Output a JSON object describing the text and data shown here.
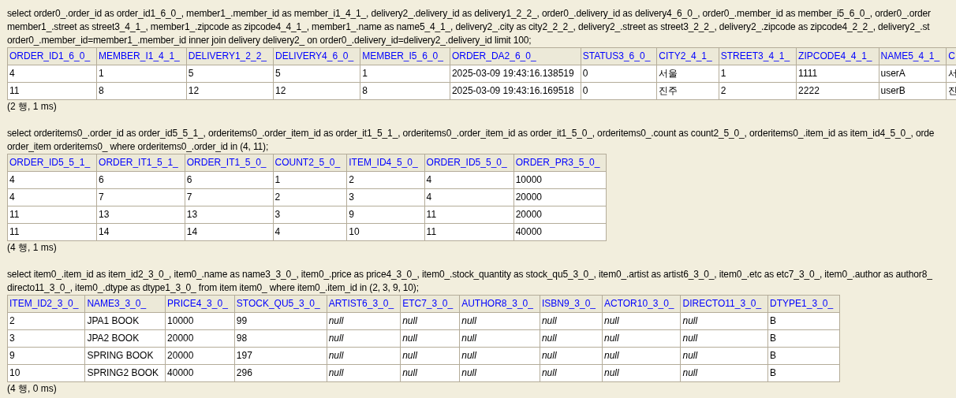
{
  "results": [
    {
      "sql": [
        "select order0_.order_id as order_id1_6_0_, member1_.member_id as member_i1_4_1_, delivery2_.delivery_id as delivery1_2_2_, order0_.delivery_id as delivery4_6_0_, order0_.member_id as member_i5_6_0_, order0_.order",
        "member1_.street as street3_4_1_, member1_.zipcode as zipcode4_4_1_, member1_.name as name5_4_1_, delivery2_.city as city2_2_2_, delivery2_.street as street3_2_2_, delivery2_.zipcode as zipcode4_2_2_, delivery2_.st",
        "order0_.member_id=member1_.member_id inner join delivery delivery2_ on order0_.delivery_id=delivery2_.delivery_id limit 100;"
      ],
      "columns": [
        {
          "label": "ORDER_ID1_6_0_",
          "kind": "text"
        },
        {
          "label": "MEMBER_I1_4_1_",
          "kind": "text"
        },
        {
          "label": "DELIVERY1_2_2_",
          "kind": "text"
        },
        {
          "label": "DELIVERY4_6_0_",
          "kind": "text"
        },
        {
          "label": "MEMBER_I5_6_0_",
          "kind": "text"
        },
        {
          "label": "ORDER_DA2_6_0_",
          "kind": "text"
        },
        {
          "label": "STATUS3_6_0_",
          "kind": "text"
        },
        {
          "label": "CITY2_4_1_",
          "kind": "text"
        },
        {
          "label": "STREET3_4_1_",
          "kind": "text"
        },
        {
          "label": "ZIPCODE4_4_1_",
          "kind": "text"
        },
        {
          "label": "NAME5_4_1_",
          "kind": "text"
        },
        {
          "label": "C",
          "kind": "text"
        }
      ],
      "rows": [
        [
          "4",
          "1",
          "5",
          "5",
          "1",
          "2025-03-09 19:43:16.138519",
          "0",
          "서울",
          "1",
          "1111",
          "userA",
          "서"
        ],
        [
          "11",
          "8",
          "12",
          "12",
          "8",
          "2025-03-09 19:43:16.169518",
          "0",
          "진주",
          "2",
          "2222",
          "userB",
          "진"
        ]
      ],
      "footer": "(2 행, 1 ms)"
    },
    {
      "sql": [
        "select orderitems0_.order_id as order_id5_5_1_, orderitems0_.order_item_id as order_it1_5_1_, orderitems0_.order_item_id as order_it1_5_0_, orderitems0_.count as count2_5_0_, orderitems0_.item_id as item_id4_5_0_, orde",
        "order_item orderitems0_ where orderitems0_.order_id in (4, 11);"
      ],
      "columns": [
        {
          "label": "ORDER_ID5_5_1_",
          "kind": "text"
        },
        {
          "label": "ORDER_IT1_5_1_",
          "kind": "text"
        },
        {
          "label": "ORDER_IT1_5_0_",
          "kind": "text"
        },
        {
          "label": "COUNT2_5_0_",
          "kind": "text"
        },
        {
          "label": "ITEM_ID4_5_0_",
          "kind": "text"
        },
        {
          "label": "ORDER_ID5_5_0_",
          "kind": "text"
        },
        {
          "label": "ORDER_PR3_5_0_",
          "kind": "text"
        }
      ],
      "rows": [
        [
          "4",
          "6",
          "6",
          "1",
          "2",
          "4",
          "10000"
        ],
        [
          "4",
          "7",
          "7",
          "2",
          "3",
          "4",
          "20000"
        ],
        [
          "11",
          "13",
          "13",
          "3",
          "9",
          "11",
          "20000"
        ],
        [
          "11",
          "14",
          "14",
          "4",
          "10",
          "11",
          "40000"
        ]
      ],
      "footer": "(4 행, 1 ms)"
    },
    {
      "sql": [
        "select item0_.item_id as item_id2_3_0_, item0_.name as name3_3_0_, item0_.price as price4_3_0_, item0_.stock_quantity as stock_qu5_3_0_, item0_.artist as artist6_3_0_, item0_.etc as etc7_3_0_, item0_.author as author8_",
        "directo11_3_0_, item0_.dtype as dtype1_3_0_ from item item0_ where item0_.item_id in (2, 3, 9, 10);"
      ],
      "columns": [
        {
          "label": "ITEM_ID2_3_0_",
          "kind": "text"
        },
        {
          "label": "NAME3_3_0_",
          "kind": "text"
        },
        {
          "label": "PRICE4_3_0_",
          "kind": "text"
        },
        {
          "label": "STOCK_QU5_3_0_",
          "kind": "text"
        },
        {
          "label": "ARTIST6_3_0_",
          "kind": "null"
        },
        {
          "label": "ETC7_3_0_",
          "kind": "null"
        },
        {
          "label": "AUTHOR8_3_0_",
          "kind": "null"
        },
        {
          "label": "ISBN9_3_0_",
          "kind": "null"
        },
        {
          "label": "ACTOR10_3_0_",
          "kind": "null"
        },
        {
          "label": "DIRECTO11_3_0_",
          "kind": "null"
        },
        {
          "label": "DTYPE1_3_0_",
          "kind": "text"
        }
      ],
      "rows": [
        [
          "2",
          "JPA1 BOOK",
          "10000",
          "99",
          "null",
          "null",
          "null",
          "null",
          "null",
          "null",
          "B"
        ],
        [
          "3",
          "JPA2 BOOK",
          "20000",
          "98",
          "null",
          "null",
          "null",
          "null",
          "null",
          "null",
          "B"
        ],
        [
          "9",
          "SPRING BOOK",
          "20000",
          "197",
          "null",
          "null",
          "null",
          "null",
          "null",
          "null",
          "B"
        ],
        [
          "10",
          "SPRING2 BOOK",
          "40000",
          "296",
          "null",
          "null",
          "null",
          "null",
          "null",
          "null",
          "B"
        ]
      ],
      "footer": "(4 행, 0 ms)"
    }
  ]
}
